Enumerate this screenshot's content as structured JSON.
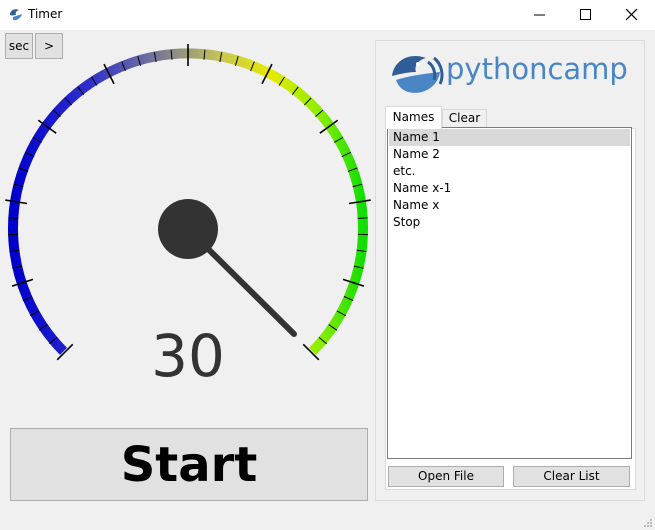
{
  "window": {
    "title": "Timer",
    "controls": [
      "minimize",
      "maximize",
      "close"
    ]
  },
  "toolbar": {
    "unit_label": "sec",
    "next_label": ">"
  },
  "gauge": {
    "value": 30,
    "display": "30",
    "unit": "sec",
    "colors": [
      "#0000d0",
      "#7070a0",
      "#e6e600",
      "#22dd00"
    ],
    "needle_color": "#333333"
  },
  "start_button": {
    "label": "Start"
  },
  "logo": {
    "text": "pythoncamp",
    "color": "#4a86c6"
  },
  "tabs": [
    {
      "label": "Names",
      "active": true
    },
    {
      "label": "Clear",
      "active": false
    }
  ],
  "names_list": {
    "items": [
      "Name 1",
      "Name 2",
      "etc.",
      "Name x-1",
      "Name x",
      "Stop"
    ],
    "selected_index": 0
  },
  "buttons": {
    "open_file": "Open File",
    "clear_list": "Clear List"
  }
}
